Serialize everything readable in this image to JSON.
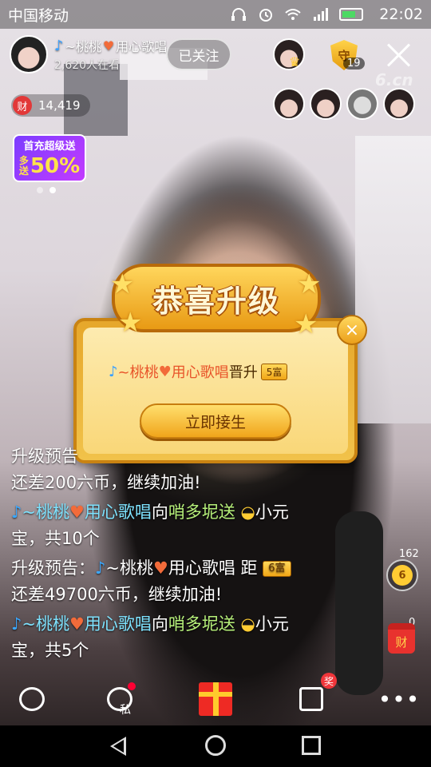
{
  "status_bar": {
    "carrier": "中国移动",
    "time": "22:02",
    "network": "4G"
  },
  "host": {
    "name": "~桃桃",
    "name_suffix": "用心歌唱",
    "viewers": "2,620人在看",
    "follow_label": "已关注"
  },
  "top_right": {
    "guard_count": "19",
    "guard_badge": "守",
    "watermark": "6.cn"
  },
  "wealth": {
    "badge": "财",
    "value": "14,419"
  },
  "promo": {
    "line1": "首充超级送",
    "small1": "多",
    "small2": "送",
    "percent": "50%"
  },
  "dialog": {
    "title": "恭喜升级",
    "user": "~桃桃",
    "user_suffix": "用心歌唱",
    "action": "晋升",
    "level": "5富",
    "button": "立即接生",
    "close": "×"
  },
  "chat": {
    "msg1_line1": "升级预告",
    "msg1_line2": "还差200六币，继续加油!",
    "msg2_user": "~桃桃",
    "msg2_user_suffix": "用心歌唱",
    "msg2_to": "向",
    "msg2_target": "哨多坭送",
    "msg2_item": "小元",
    "msg2_line2": "宝，共10个",
    "msg3_prefix": "升级预告：",
    "msg3_user": "~桃桃",
    "msg3_user_suffix": "用心歌唱",
    "msg3_dist": "距",
    "msg3_level": "6富",
    "msg3_line2": "还差49700六币，继续加油!",
    "msg4_user": "~桃桃",
    "msg4_user_suffix": "用心歌唱",
    "msg4_to": "向",
    "msg4_target": "哨多坭送",
    "msg4_item": "小元",
    "msg4_line2": "宝，共5个"
  },
  "side": {
    "fan_count": "162",
    "fan_badge": "6",
    "redbag_count": "0",
    "redbag_label": "财"
  },
  "actions": {
    "private_label": "私",
    "share_badge": "奖",
    "more": "•••"
  },
  "colors": {
    "accent_gold": "#f0a617",
    "name_cyan": "#7ee3ff",
    "heart": "#f26b3a"
  }
}
